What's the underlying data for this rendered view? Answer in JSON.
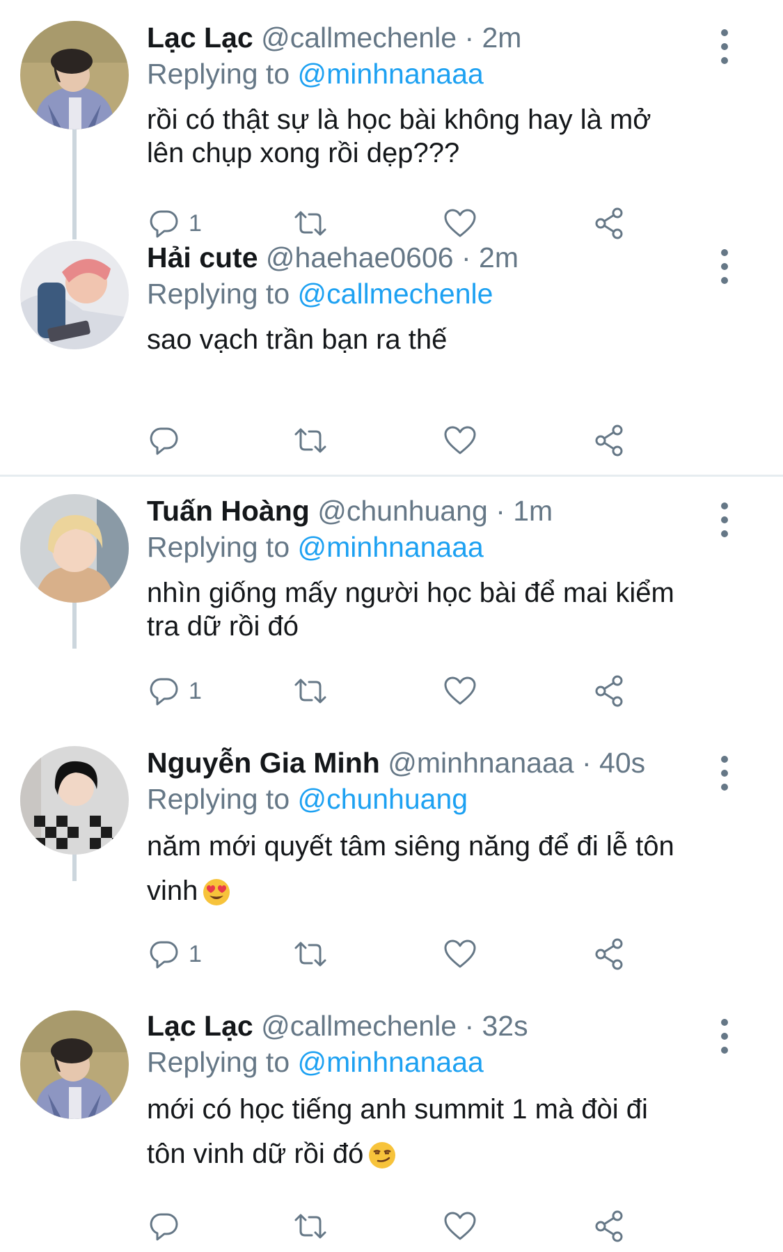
{
  "tweets": [
    {
      "name": "Lạc Lạc",
      "handle": "@callmechenle",
      "dot": "·",
      "time": "2m",
      "replying_prefix": "Replying to",
      "replying_to": "@minhnanaaa",
      "lines": [
        "rồi có thật sự là học bài không hay là mở",
        "lên chụp xong rồi dẹp???"
      ],
      "reply_count": "1"
    },
    {
      "name": "Hải cute",
      "handle": "@haehae0606",
      "dot": "·",
      "time": "2m",
      "replying_prefix": "Replying to",
      "replying_to": "@callmechenle",
      "lines": [
        "sao vạch trần bạn ra thế"
      ],
      "reply_count": ""
    },
    {
      "name": "Tuấn Hoàng",
      "handle": "@chunhuang",
      "dot": "·",
      "time": "1m",
      "replying_prefix": "Replying to",
      "replying_to": "@minhnanaaa",
      "lines": [
        "nhìn giống mấy người học bài để mai kiểm",
        "tra dữ rồi đó"
      ],
      "reply_count": "1"
    },
    {
      "name": "Nguyễn Gia Minh",
      "handle": "@minhnanaaa",
      "dot": "·",
      "time": "40s",
      "replying_prefix": "Replying to",
      "replying_to": "@chunhuang",
      "lines": [
        "năm mới quyết tâm siêng năng để đi lễ tôn",
        "vinh"
      ],
      "emoji": "heart-eyes-emoji",
      "reply_count": "1"
    },
    {
      "name": "Lạc Lạc",
      "handle": "@callmechenle",
      "dot": "·",
      "time": "32s",
      "replying_prefix": "Replying to",
      "replying_to": "@minhnanaaa",
      "lines": [
        "mới có học tiếng anh summit 1 mà đòi đi",
        "tôn vinh dữ rồi đó"
      ],
      "emoji": "smirk-emoji",
      "reply_count": ""
    }
  ],
  "icons": {
    "reply": "reply-icon",
    "retweet": "retweet-icon",
    "like": "like-icon",
    "share": "share-icon",
    "more": "more-options-icon"
  },
  "colors": {
    "text": "#14171a",
    "secondary": "#657786",
    "link": "#1da1f2",
    "thread_line": "#ccd6dd",
    "divider": "#e6ecf0"
  }
}
